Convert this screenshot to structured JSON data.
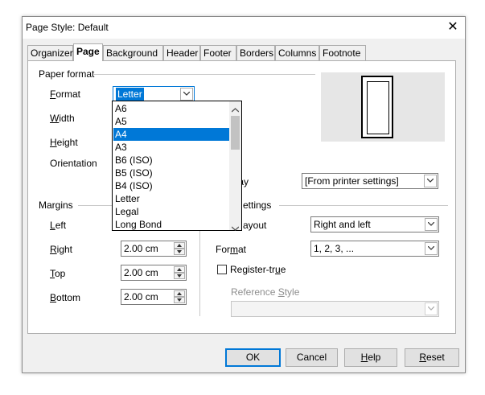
{
  "window": {
    "title": "Page Style: Default",
    "close_glyph": "✕"
  },
  "tabs": [
    "Organizer",
    "Page",
    "Background",
    "Header",
    "Footer",
    "Borders",
    "Columns",
    "Footnote"
  ],
  "active_tab": "Page",
  "paper_format": {
    "section_label": "Paper format",
    "format_label": "Format",
    "format_value": "Letter",
    "width_label": "Width",
    "height_label": "Height",
    "orientation_label": "Orientation",
    "dropdown_options": [
      "A6",
      "A5",
      "A4",
      "A3",
      "B6 (ISO)",
      "B5 (ISO)",
      "B4 (ISO)",
      "Letter",
      "Legal",
      "Long Bond"
    ],
    "highlighted_option": "A4"
  },
  "paper_tray": {
    "label": "tray",
    "value": "[From printer settings]"
  },
  "margins": {
    "section_label": "Margins",
    "left_label": "Left",
    "right_label": "Right",
    "right_value": "2.00 cm",
    "top_label": "Top",
    "top_value": "2.00 cm",
    "bottom_label": "Bottom",
    "bottom_value": "2.00 cm"
  },
  "layout_settings": {
    "section_label": "ettings",
    "layout_label": "ayout",
    "layout_value": "Right and left",
    "format_label": "Format",
    "format_value": "1, 2, 3, ...",
    "register_label": "Register-true",
    "register_checked": false,
    "reference_style_label": "Reference Style",
    "reference_style_value": ""
  },
  "buttons": {
    "ok": "OK",
    "cancel": "Cancel",
    "help": "Help",
    "reset": "Reset"
  },
  "colors": {
    "selection": "#0078d7",
    "dialog_bg": "#f0f0f0"
  }
}
